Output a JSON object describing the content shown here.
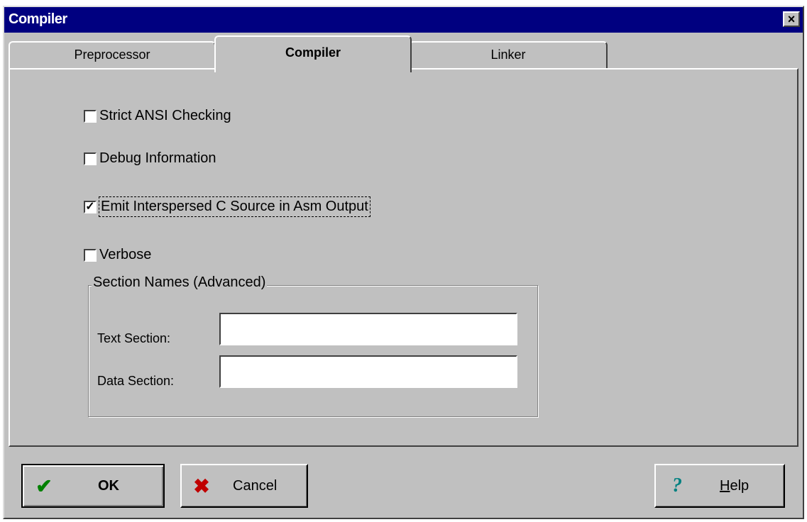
{
  "window": {
    "title": "Compiler",
    "close_glyph": "×"
  },
  "tabs": [
    {
      "label": "Preprocessor",
      "active": false
    },
    {
      "label": "Compiler",
      "active": true
    },
    {
      "label": "Linker",
      "active": false
    }
  ],
  "options": [
    {
      "label": "Strict ANSI Checking",
      "checked": false
    },
    {
      "label": "Debug Information",
      "checked": false
    },
    {
      "label": "Emit Interspersed C Source in Asm Output",
      "checked": true
    },
    {
      "label": "Verbose",
      "checked": false
    }
  ],
  "section_names": {
    "legend": "Section Names (Advanced)",
    "text_section_label": "Text Section:",
    "text_section_value": "",
    "data_section_label": "Data Section:",
    "data_section_value": ""
  },
  "buttons": {
    "ok": {
      "label": "OK",
      "icon": "checkmark-icon"
    },
    "cancel": {
      "label": "Cancel",
      "icon": "x-icon"
    },
    "help": {
      "label_first": "H",
      "label_rest": "elp",
      "icon": "question-icon"
    }
  },
  "colors": {
    "titlebar": "#000080",
    "face": "#c0c0c0",
    "ok_icon": "#008000",
    "cancel_icon": "#c00000",
    "help_icon": "#008080"
  }
}
